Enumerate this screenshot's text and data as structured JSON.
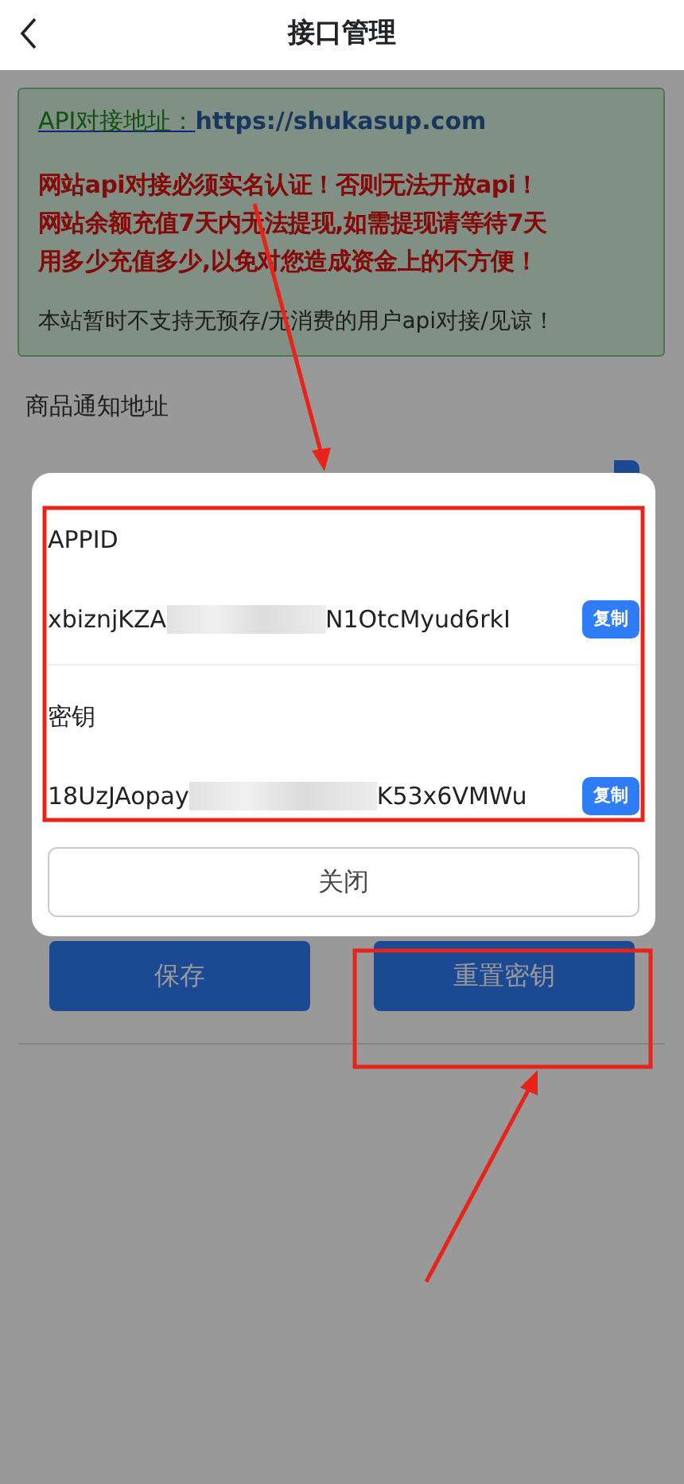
{
  "header": {
    "title": "接口管理"
  },
  "notice": {
    "api_label": "API对接地址：",
    "api_url": "https://shukasup.com",
    "warnings": [
      "网站api对接必须实名认证！否则无法开放api！",
      "网站余额充值7天内无法提现,如需提现请等待7天",
      "用多少充值多少,以免对您造成资金上的不方便！"
    ],
    "note": "本站暂时不支持无预存/无消费的用户api对接/见谅！"
  },
  "form": {
    "notify_label": "商品通知地址"
  },
  "buttons": [
    "保存",
    "重置密钥"
  ],
  "modal": {
    "fields": [
      {
        "label": "APPID",
        "value_start": "xbiznjKZA",
        "value_end": "N1OtcMyud6rkI",
        "copy_button": "复制"
      },
      {
        "label": "密钥",
        "value_start": "18UzJAopay",
        "value_end": "K53x6VMWu",
        "copy_button": "复制"
      }
    ],
    "close_button": "关闭"
  }
}
